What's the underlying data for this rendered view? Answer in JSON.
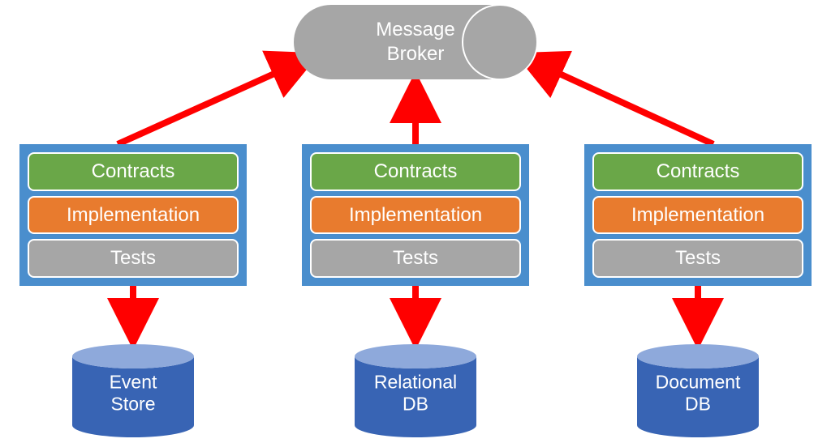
{
  "broker": {
    "label": "Message\nBroker"
  },
  "services": [
    {
      "contracts": "Contracts",
      "implementation": "Implementation",
      "tests": "Tests"
    },
    {
      "contracts": "Contracts",
      "implementation": "Implementation",
      "tests": "Tests"
    },
    {
      "contracts": "Contracts",
      "implementation": "Implementation",
      "tests": "Tests"
    }
  ],
  "databases": [
    {
      "label": "Event\nStore"
    },
    {
      "label": "Relational\nDB"
    },
    {
      "label": "Document\nDB"
    }
  ],
  "colors": {
    "broker": "#A6A6A6",
    "serviceBox": "#4A8ECD",
    "contracts": "#6AA748",
    "implementation": "#E87B2E",
    "tests": "#A6A6A6",
    "dbSide": "#3864B4",
    "dbTop": "#8EA9DB",
    "arrow": "#FF0000"
  }
}
